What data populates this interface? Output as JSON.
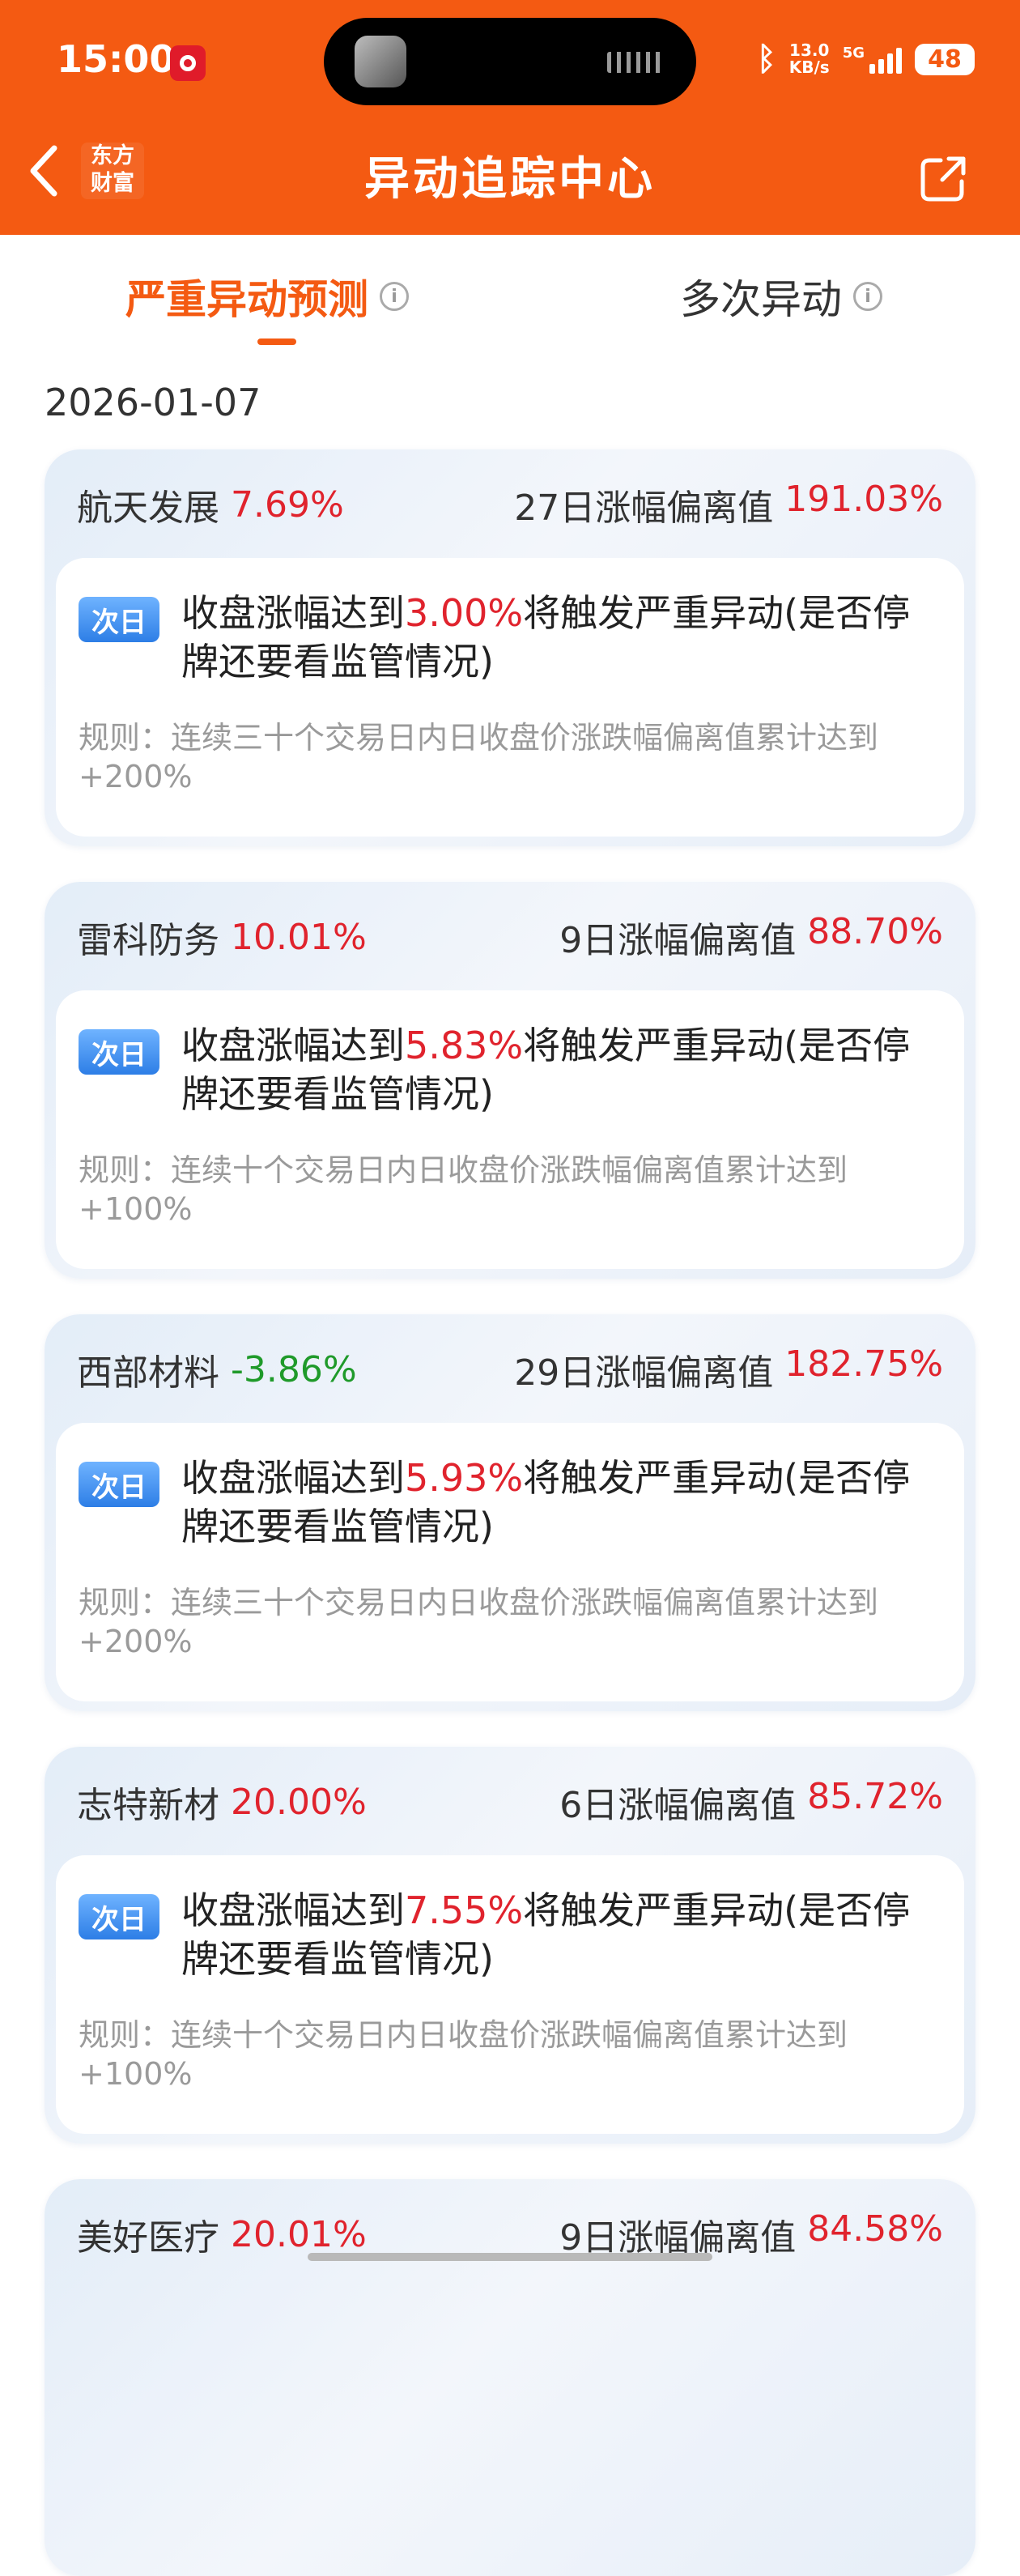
{
  "status_bar": {
    "time": "15:00",
    "net_speed_value": "13.0",
    "net_speed_unit": "KB/s",
    "network": "5G",
    "battery": "48"
  },
  "header": {
    "title": "异动追踪中心",
    "logo_line1": "东方",
    "logo_line2": "财富"
  },
  "tabs": [
    {
      "label": "严重异动预测",
      "active": true
    },
    {
      "label": "多次异动",
      "active": false
    }
  ],
  "date": "2026-01-07",
  "colors": {
    "accent": "#f45a12",
    "up": "#e0232d",
    "down": "#1f9a2a"
  },
  "cards": [
    {
      "name": "航天发展",
      "change": "7.69%",
      "trend": "up",
      "dev_label": "27日涨幅偏离值",
      "dev_value": "191.03%",
      "badge": "次日",
      "text_before": "收盘涨幅达到",
      "threshold": "3.00%",
      "text_after": "将触发严重异动(是否停牌还要看监管情况)",
      "rule": "规则：连续三十个交易日内日收盘价涨跌幅偏离值累计达到+200%"
    },
    {
      "name": "雷科防务",
      "change": "10.01%",
      "trend": "up",
      "dev_label": "9日涨幅偏离值",
      "dev_value": "88.70%",
      "badge": "次日",
      "text_before": "收盘涨幅达到",
      "threshold": "5.83%",
      "text_after": "将触发严重异动(是否停牌还要看监管情况)",
      "rule": "规则：连续十个交易日内日收盘价涨跌幅偏离值累计达到+100%"
    },
    {
      "name": "西部材料",
      "change": "-3.86%",
      "trend": "down",
      "dev_label": "29日涨幅偏离值",
      "dev_value": "182.75%",
      "badge": "次日",
      "text_before": "收盘涨幅达到",
      "threshold": "5.93%",
      "text_after": "将触发严重异动(是否停牌还要看监管情况)",
      "rule": "规则：连续三十个交易日内日收盘价涨跌幅偏离值累计达到+200%"
    },
    {
      "name": "志特新材",
      "change": "20.00%",
      "trend": "up",
      "dev_label": "6日涨幅偏离值",
      "dev_value": "85.72%",
      "badge": "次日",
      "text_before": "收盘涨幅达到",
      "threshold": "7.55%",
      "text_after": "将触发严重异动(是否停牌还要看监管情况)",
      "rule": "规则：连续十个交易日内日收盘价涨跌幅偏离值累计达到+100%"
    },
    {
      "name": "美好医疗",
      "change": "20.01%",
      "trend": "up",
      "dev_label": "9日涨幅偏离值",
      "dev_value": "84.58%"
    }
  ]
}
